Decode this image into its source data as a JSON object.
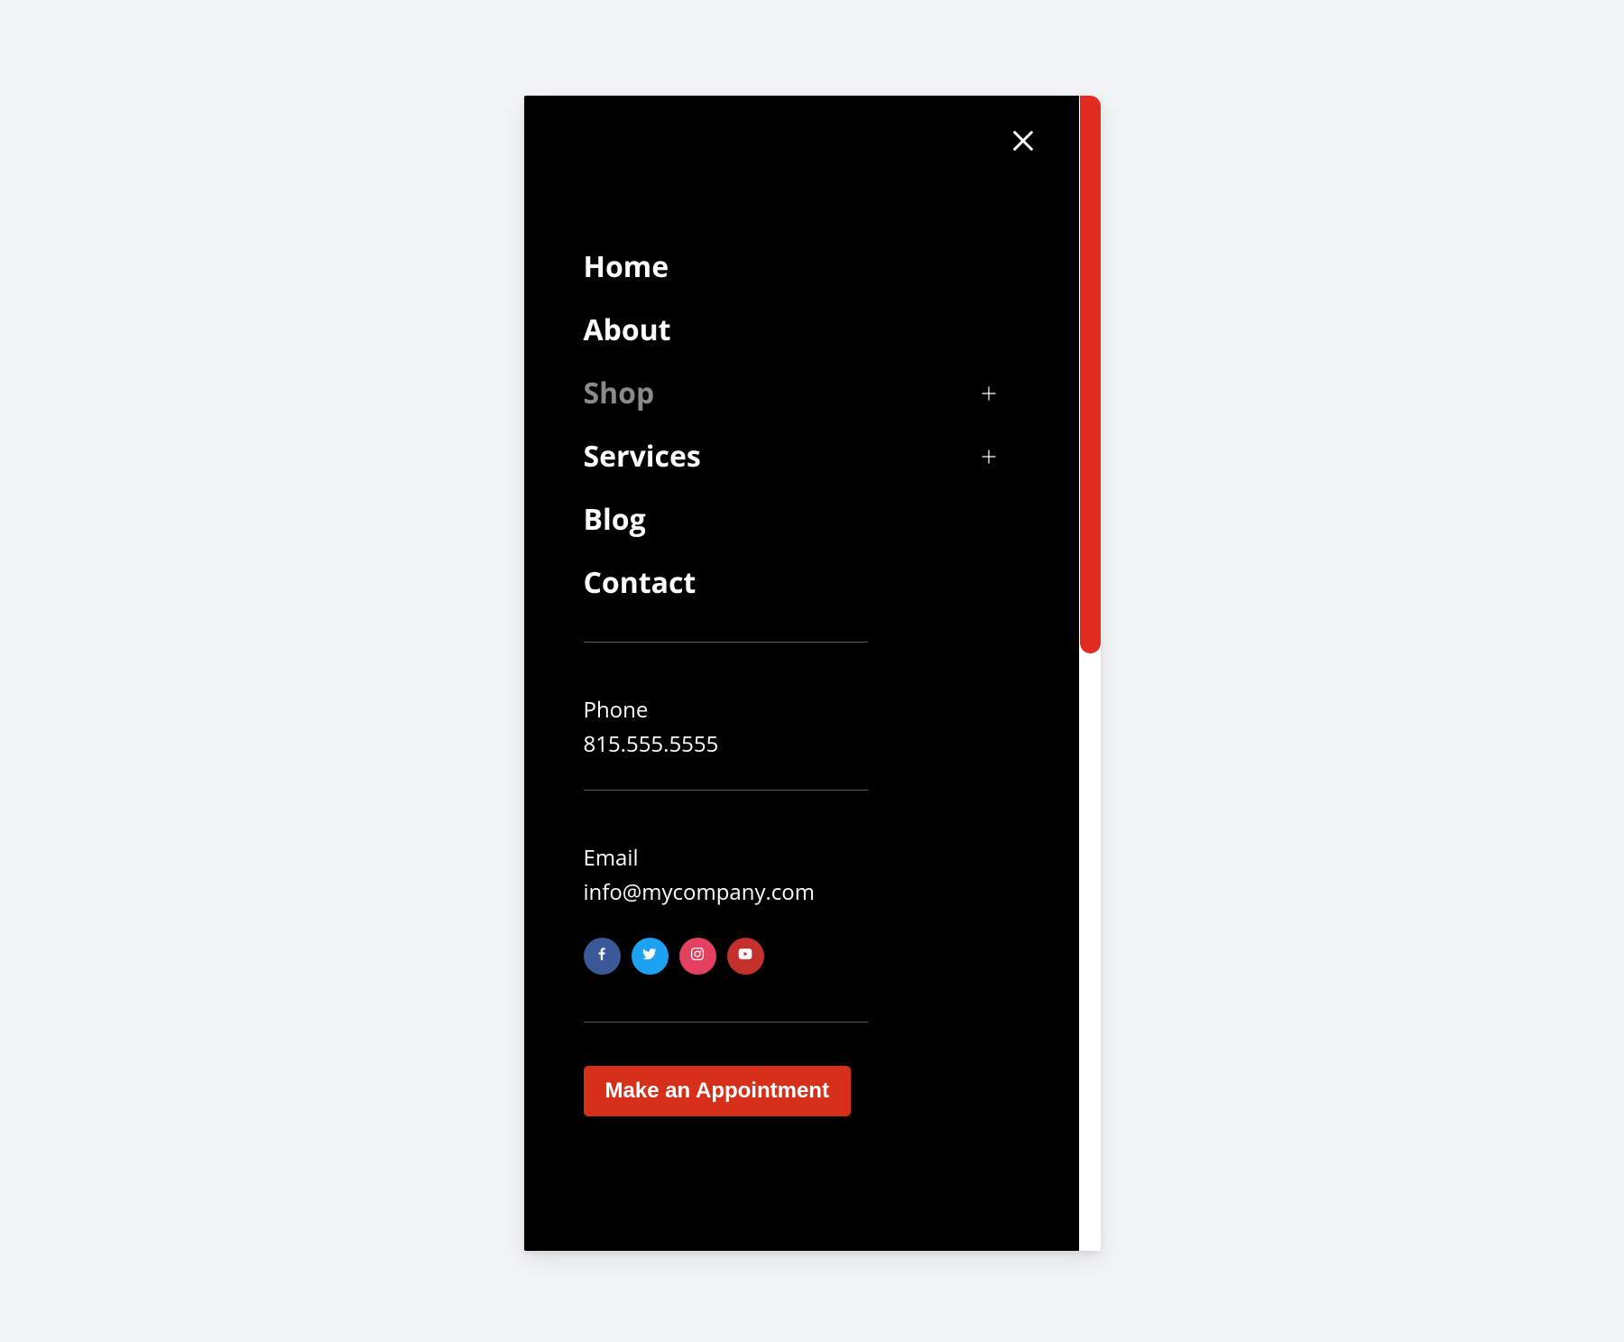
{
  "nav": {
    "items": [
      {
        "label": "Home",
        "expandable": false,
        "muted": false
      },
      {
        "label": "About",
        "expandable": false,
        "muted": false
      },
      {
        "label": "Shop",
        "expandable": true,
        "muted": true
      },
      {
        "label": "Services",
        "expandable": true,
        "muted": false
      },
      {
        "label": "Blog",
        "expandable": false,
        "muted": false
      },
      {
        "label": "Contact",
        "expandable": false,
        "muted": false
      }
    ]
  },
  "contact": {
    "phone_label": "Phone",
    "phone_value": "815.555.5555",
    "email_label": "Email",
    "email_value": "info@mycompany.com"
  },
  "socials": {
    "facebook": "facebook",
    "twitter": "twitter",
    "instagram": "instagram",
    "youtube": "youtube"
  },
  "cta": {
    "label": "Make an Appointment"
  }
}
